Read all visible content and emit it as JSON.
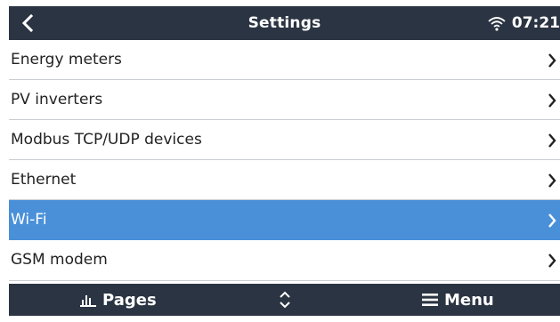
{
  "header": {
    "title": "Settings",
    "clock": "07:21",
    "icons": {
      "back": "chevron-left-icon",
      "wifi": "wifi-icon"
    }
  },
  "list": {
    "items": [
      {
        "label": "Energy meters",
        "selected": false
      },
      {
        "label": "PV inverters",
        "selected": false
      },
      {
        "label": "Modbus TCP/UDP devices",
        "selected": false
      },
      {
        "label": "Ethernet",
        "selected": false
      },
      {
        "label": "Wi-Fi",
        "selected": true
      },
      {
        "label": "GSM modem",
        "selected": false
      }
    ]
  },
  "footer": {
    "pages_label": "Pages",
    "menu_label": "Menu",
    "icons": {
      "pages": "bar-chart-icon",
      "scroll": "up-down-icon",
      "menu": "hamburger-icon"
    }
  },
  "colors": {
    "header_bg": "#2b3442",
    "selected_bg": "#4a90d9",
    "divider": "#c9ccd0"
  }
}
